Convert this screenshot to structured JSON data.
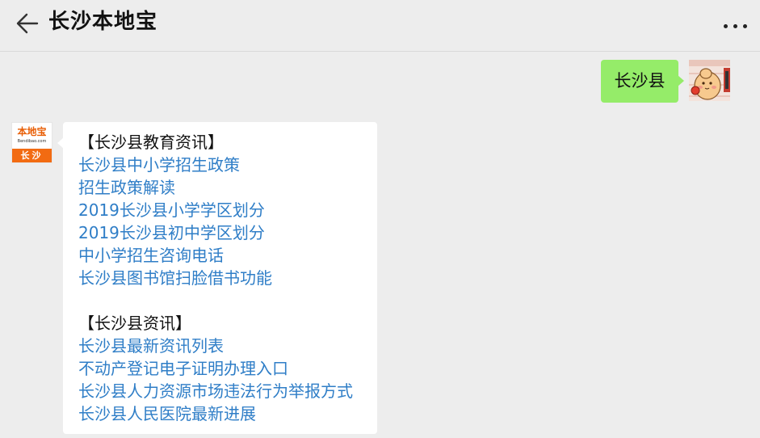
{
  "header": {
    "title": "长沙本地宝",
    "back_icon": "arrow-left-icon",
    "more_icon": "more-dots-icon"
  },
  "outgoing": {
    "text": "长沙县",
    "bubble_color": "#95ec69"
  },
  "bot": {
    "avatar_logo": "本地宝",
    "avatar_domain": "Bendibao.com",
    "avatar_city": "长沙",
    "accent": "#f26b12"
  },
  "message": {
    "sections": [
      {
        "title": "【长沙县教育资讯】",
        "links": [
          "长沙县中小学招生政策",
          "招生政策解读",
          "2019长沙县小学学区划分",
          "2019长沙县初中学区划分",
          "中小学招生咨询电话",
          "长沙县图书馆扫脸借书功能"
        ]
      },
      {
        "title": "【长沙县资讯】",
        "links": [
          "长沙县最新资讯列表",
          "不动产登记电子证明办理入口",
          "长沙县人力资源市场违法行为举报方式",
          "长沙县人民医院最新进展"
        ]
      }
    ],
    "link_color": "#2f7ec7"
  }
}
